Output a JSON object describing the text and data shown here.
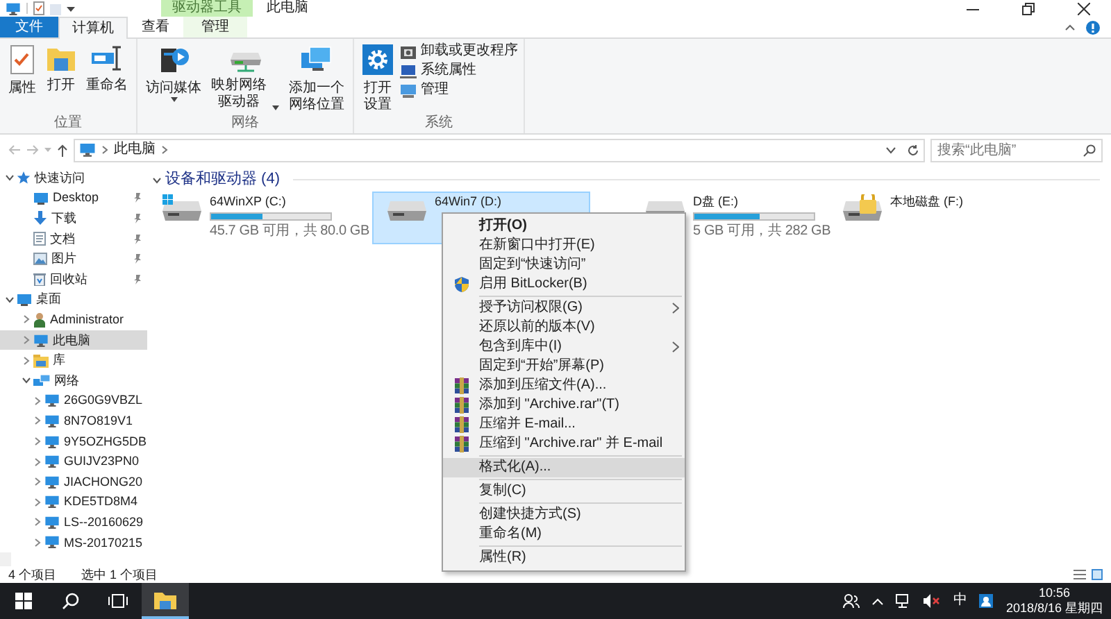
{
  "title_bar": {
    "context_tab": "驱动器工具",
    "title": "此电脑"
  },
  "ribbon_tabs": [
    {
      "label": "文件",
      "kind": "file",
      "selected": false
    },
    {
      "label": "计算机",
      "kind": "tab",
      "selected": true
    },
    {
      "label": "查看",
      "kind": "tab",
      "selected": false
    },
    {
      "label": "管理",
      "kind": "context",
      "selected": false
    }
  ],
  "ribbon": {
    "groups": [
      {
        "label": "位置",
        "buttons": [
          {
            "lines": [
              "属性"
            ],
            "kind": "large",
            "dropdown": false
          },
          {
            "lines": [
              "打开"
            ],
            "kind": "large",
            "dropdown": false
          },
          {
            "lines": [
              "重命名"
            ],
            "kind": "large",
            "dropdown": false
          }
        ]
      },
      {
        "label": "网络",
        "buttons": [
          {
            "lines": [
              "访问媒体"
            ],
            "kind": "large",
            "dropdown": true
          },
          {
            "lines": [
              "映射网络",
              "驱动器"
            ],
            "kind": "large",
            "dropdown": true
          },
          {
            "lines": [
              "添加一个",
              "网络位置"
            ],
            "kind": "large",
            "dropdown": false
          }
        ]
      },
      {
        "label": "系统",
        "buttons": [
          {
            "lines": [
              "打开",
              "设置"
            ],
            "kind": "large",
            "dropdown": false
          },
          {
            "lines": [
              "卸载或更改程序"
            ],
            "kind": "small",
            "dropdown": false
          },
          {
            "lines": [
              "系统属性"
            ],
            "kind": "small",
            "dropdown": false
          },
          {
            "lines": [
              "管理"
            ],
            "kind": "small",
            "dropdown": false
          }
        ]
      }
    ]
  },
  "address_bar": {
    "path": [
      "此电脑"
    ],
    "search_placeholder": "搜索“此电脑”"
  },
  "navigation_pane": [
    {
      "label": "快速访问",
      "kind": "star",
      "expanded": true,
      "selected": false,
      "children": [
        {
          "label": "Desktop",
          "kind": "desktop",
          "pinned": true,
          "selected": false
        },
        {
          "label": "下载",
          "kind": "download",
          "pinned": true,
          "selected": false
        },
        {
          "label": "文档",
          "kind": "document",
          "pinned": true,
          "selected": false
        },
        {
          "label": "图片",
          "kind": "picture",
          "pinned": true,
          "selected": false
        },
        {
          "label": "回收站",
          "kind": "recycle",
          "pinned": true,
          "selected": false
        }
      ]
    },
    {
      "label": "桌面",
      "kind": "desktop",
      "expanded": true,
      "selected": false,
      "children": [
        {
          "label": "Administrator",
          "kind": "user",
          "expanded": false,
          "selected": false
        },
        {
          "label": "此电脑",
          "kind": "pc",
          "expanded": false,
          "selected": true
        },
        {
          "label": "库",
          "kind": "library",
          "expanded": false,
          "selected": false
        },
        {
          "label": "网络",
          "kind": "network",
          "expanded": true,
          "selected": false,
          "children": [
            {
              "label": "26G0G9VBZL",
              "kind": "pc",
              "expanded": false,
              "selected": false
            },
            {
              "label": "8N7O819V1",
              "kind": "pc",
              "expanded": false,
              "selected": false
            },
            {
              "label": "9Y5OZHG5DB",
              "kind": "pc",
              "expanded": false,
              "selected": false
            },
            {
              "label": "GUIJV23PN0",
              "kind": "pc",
              "expanded": false,
              "selected": false
            },
            {
              "label": "JIACHONG20",
              "kind": "pc",
              "expanded": false,
              "selected": false
            },
            {
              "label": "KDE5TD8M4",
              "kind": "pc",
              "expanded": false,
              "selected": false
            },
            {
              "label": "LS--20160629",
              "kind": "pc",
              "expanded": false,
              "selected": false
            },
            {
              "label": "MS-20170215",
              "kind": "pc",
              "expanded": false,
              "selected": false
            }
          ]
        }
      ]
    }
  ],
  "content": {
    "group_label": "设备和驱动器 (4)",
    "group_expanded": true,
    "drives": [
      {
        "name": "64WinXP (C:)",
        "kind": "windows",
        "level": 0.43,
        "space": "45.7 GB 可用，共 80.0 GB",
        "selected": false
      },
      {
        "name": "64Win7 (D:)",
        "kind": "disk",
        "selected": true
      },
      {
        "name": "D盘 (E:)",
        "kind": "disk",
        "level": 0.55,
        "space": "5 GB 可用，共 282 GB",
        "selected": false
      },
      {
        "name": "本地磁盘 (F:)",
        "kind": "locked",
        "selected": false
      }
    ]
  },
  "context_menu": {
    "sections": [
      [
        {
          "label": "打开(O)",
          "kind": "default",
          "submenu": false,
          "selected": false
        },
        {
          "label": "在新窗口中打开(E)",
          "kind": "plain",
          "submenu": false,
          "selected": false
        },
        {
          "label": "固定到“快速访问”",
          "kind": "plain",
          "submenu": false,
          "selected": false
        },
        {
          "label": "启用 BitLocker(B)",
          "kind": "shield",
          "submenu": false,
          "selected": false
        }
      ],
      [
        {
          "label": "授予访问权限(G)",
          "kind": "plain",
          "submenu": true,
          "selected": false
        },
        {
          "label": "还原以前的版本(V)",
          "kind": "plain",
          "submenu": false,
          "selected": false
        },
        {
          "label": "包含到库中(I)",
          "kind": "plain",
          "submenu": true,
          "selected": false
        },
        {
          "label": "固定到“开始”屏幕(P)",
          "kind": "plain",
          "submenu": false,
          "selected": false
        },
        {
          "label": "添加到压缩文件(A)...",
          "kind": "archive",
          "submenu": false,
          "selected": false
        },
        {
          "label": "添加到 \"Archive.rar\"(T)",
          "kind": "archive",
          "submenu": false,
          "selected": false
        },
        {
          "label": "压缩并 E-mail...",
          "kind": "archive",
          "submenu": false,
          "selected": false
        },
        {
          "label": "压缩到 \"Archive.rar\" 并 E-mail",
          "kind": "archive",
          "submenu": false,
          "selected": false
        }
      ],
      [
        {
          "label": "格式化(A)...",
          "kind": "plain",
          "submenu": false,
          "selected": true
        }
      ],
      [
        {
          "label": "复制(C)",
          "kind": "plain",
          "submenu": false,
          "selected": false
        }
      ],
      [
        {
          "label": "创建快捷方式(S)",
          "kind": "plain",
          "submenu": false,
          "selected": false
        },
        {
          "label": "重命名(M)",
          "kind": "plain",
          "submenu": false,
          "selected": false
        }
      ],
      [
        {
          "label": "属性(R)",
          "kind": "plain",
          "submenu": false,
          "selected": false
        }
      ]
    ]
  },
  "status_bar": {
    "item_count": "4 个项目",
    "selection": "选中 1 个项目"
  },
  "taskbar": {
    "ime": "中",
    "time": "10:56",
    "date": "2018/8/16 星期四"
  }
}
